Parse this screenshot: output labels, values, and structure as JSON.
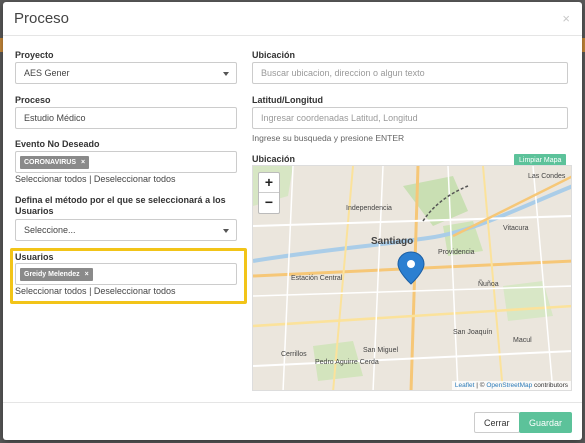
{
  "modal": {
    "title": "Proceso",
    "close_glyph": "×"
  },
  "left": {
    "proyecto_label": "Proyecto",
    "proyecto_value": "AES Gener",
    "proceso_label": "Proceso",
    "proceso_value": "Estudio Médico",
    "evento_label": "Evento No Deseado",
    "evento_tag": "CORONAVIRUS",
    "select_all": "Seleccionar todos",
    "separator": "|",
    "deselect_all": "Deseleccionar todos",
    "metodo_label_line1": "Defina el método por el que se seleccionará a los",
    "metodo_label_line2": "Usuarios",
    "metodo_value": "Seleccione...",
    "usuarios_label": "Usuarios",
    "usuarios_tag": "Greidy Melendez",
    "tag_remove_glyph": "×"
  },
  "right": {
    "ubicacion_label": "Ubicación",
    "ubicacion_placeholder": "Buscar ubicacion, direccion o algun texto",
    "latlng_label": "Latitud/Longitud",
    "latlng_placeholder": "Ingresar coordenadas Latitud, Longitud",
    "latlng_help": "Ingrese su busqueda y presione ENTER",
    "map_label": "Ubicación",
    "clear_map": "Limpiar Mapa",
    "zoom_in": "+",
    "zoom_out": "−",
    "attribution_leaflet": "Leaflet",
    "attribution_sep": " | © ",
    "attribution_osm": "OpenStreetMap",
    "attribution_suffix": " contributors",
    "places": {
      "las_condes": "Las Condes",
      "independencia": "Independencia",
      "vitacura": "Vitacura",
      "santiago": "Santiago",
      "providencia": "Providencia",
      "estacion_central": "Estación Central",
      "nunoa": "Ñuñoa",
      "san_joaquin": "San Joaquín",
      "san_miguel": "San Miguel",
      "macul": "Macul",
      "cerrillos": "Cerrillos",
      "pedro_aguirre_cerda": "Pedro Aguirre Cerda"
    }
  },
  "footer": {
    "cancel": "Cerrar",
    "save": "Guardar"
  },
  "colors": {
    "accent": "#5cc29a",
    "highlight": "#f2c418",
    "pin": "#2b7fd1"
  }
}
